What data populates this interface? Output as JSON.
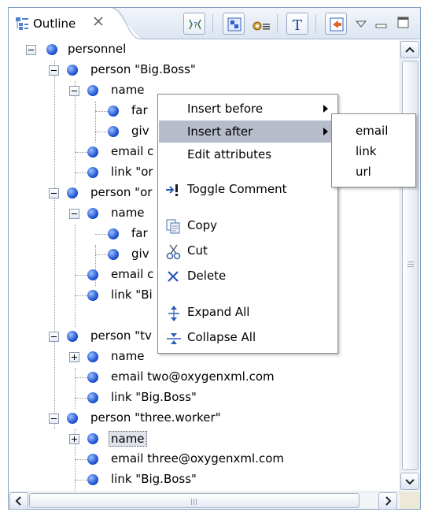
{
  "tab": {
    "label": "Outline"
  },
  "tree": {
    "rows": [
      {
        "label": "personnel"
      },
      {
        "label": "person \"Big.Boss\""
      },
      {
        "label": "name"
      },
      {
        "label": "far"
      },
      {
        "label": "giv"
      },
      {
        "label": "email c"
      },
      {
        "label": "link \"or"
      },
      {
        "label": "person \"or"
      },
      {
        "label": "name"
      },
      {
        "label": "far"
      },
      {
        "label": "giv"
      },
      {
        "label": "email c"
      },
      {
        "label": "link \"Bi"
      },
      {
        "label": "person \"tv"
      },
      {
        "label": "name"
      },
      {
        "label": "email  two@oxygenxml.com"
      },
      {
        "label": "link \"Big.Boss\""
      },
      {
        "label": "person \"three.worker\""
      },
      {
        "label": "name"
      },
      {
        "label": "email  three@oxygenxml.com"
      },
      {
        "label": "link \"Big.Boss\""
      }
    ]
  },
  "context_menu": {
    "insert_before": "Insert before",
    "insert_after": "Insert after",
    "edit_attributes": "Edit attributes",
    "toggle_comment": "Toggle Comment",
    "copy": "Copy",
    "cut": "Cut",
    "delete": "Delete",
    "expand_all": "Expand All",
    "collapse_all": "Collapse All"
  },
  "submenu": {
    "items": [
      "email",
      "link",
      "url"
    ]
  },
  "colors": {
    "node": "#1a4fcf",
    "menu_highlight": "#b7bccb",
    "selection": "#dfe4ec"
  }
}
